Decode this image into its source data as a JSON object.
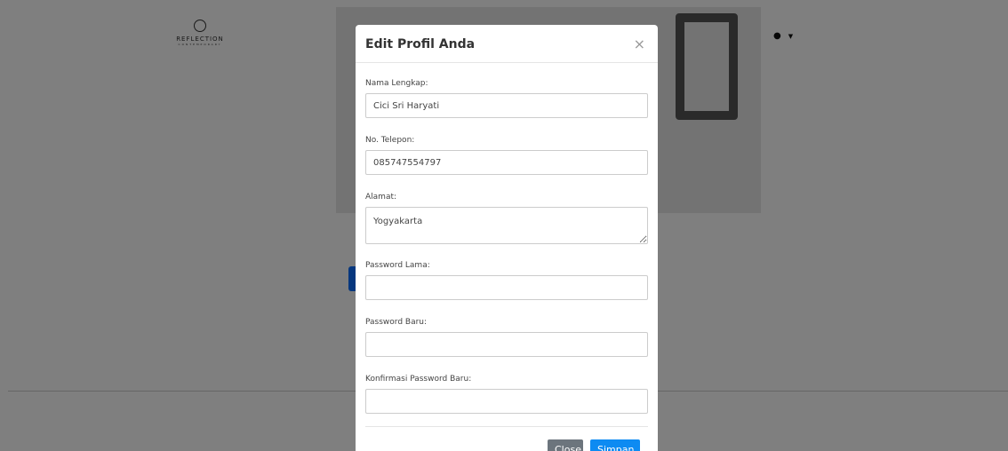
{
  "brand": {
    "name": "REFLECTION",
    "sub": "CONTEMPORARY"
  },
  "modal": {
    "title": "Edit Profil Anda",
    "close_glyph": "×",
    "fields": {
      "nama": {
        "label": "Nama Lengkap:",
        "value": "Cici Sri Haryati"
      },
      "telepon": {
        "label": "No. Telepon:",
        "value": "085747554797"
      },
      "alamat": {
        "label": "Alamat:",
        "value": "Yogyakarta"
      },
      "password_lama": {
        "label": "Password Lama:",
        "value": ""
      },
      "password_baru": {
        "label": "Password Baru:",
        "value": ""
      },
      "konfirmasi": {
        "label": "Konfirmasi Password Baru:",
        "value": ""
      }
    },
    "buttons": {
      "close": "Close",
      "save": "Simpan"
    }
  },
  "colors": {
    "primary": "#0d8bf2",
    "secondary": "#6c757d",
    "backdrop": "rgba(0,0,0,0.5)"
  },
  "icons": {
    "brand": "brand-circle-icon",
    "user": "user-circle-icon",
    "caret": "caret-down-icon",
    "close": "close-icon"
  }
}
